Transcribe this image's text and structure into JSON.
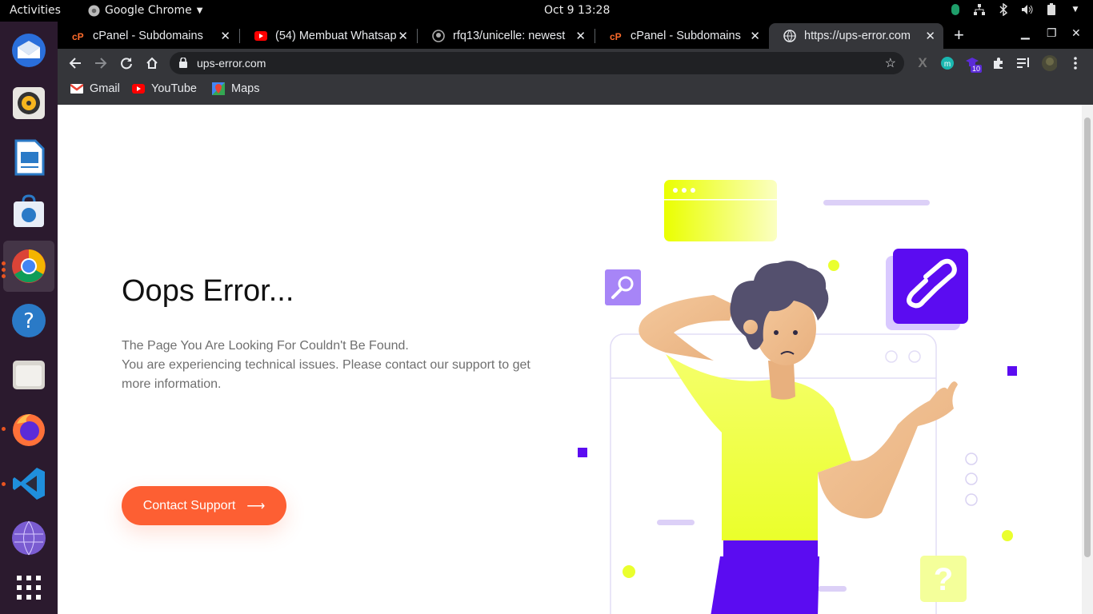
{
  "topbar": {
    "activities": "Activities",
    "app_name": "Google Chrome",
    "clock": "Oct 9  13:28"
  },
  "tabs": [
    {
      "title": "cPanel - Subdomains",
      "icon": "cpanel-icon"
    },
    {
      "title": "(54) Membuat Whatsap",
      "icon": "youtube-icon"
    },
    {
      "title": "rfq13/unicelle: newest",
      "icon": "github-icon"
    },
    {
      "title": "cPanel - Subdomains",
      "icon": "cpanel-icon"
    },
    {
      "title": "https://ups-error.com",
      "icon": "globe-icon",
      "active": true
    }
  ],
  "toolbar": {
    "url": "ups-error.com",
    "extension_badge": "10"
  },
  "bookmarks": [
    {
      "label": "Gmail",
      "icon": "gmail-icon"
    },
    {
      "label": "YouTube",
      "icon": "youtube-icon"
    },
    {
      "label": "Maps",
      "icon": "maps-icon"
    }
  ],
  "page": {
    "heading": "Oops Error...",
    "description_line1": "The Page You Are Looking For Couldn't Be Found.",
    "description_line2": "You are experiencing technical issues. Please contact our support to get more information.",
    "button_label": "Contact Support",
    "button_arrow": "⟶",
    "question_mark": "?"
  },
  "colors": {
    "accent": "#fd5f33",
    "purple": "#5b0cf1",
    "yellow": "#f1ff46"
  }
}
